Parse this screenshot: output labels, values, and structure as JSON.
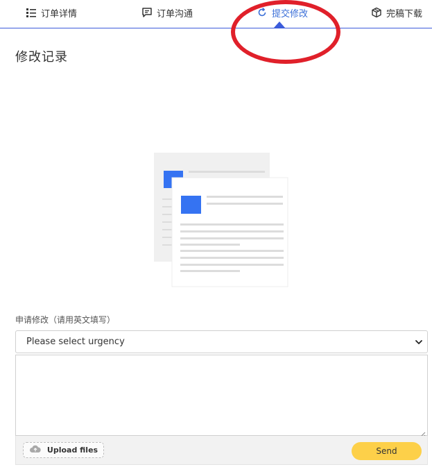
{
  "tabs": [
    {
      "label": "订单详情",
      "icon": "list-icon"
    },
    {
      "label": "订单沟通",
      "icon": "chat-icon"
    },
    {
      "label": "提交修改",
      "icon": "refresh-icon"
    },
    {
      "label": "完稿下载",
      "icon": "package-icon"
    }
  ],
  "active_tab": "提交修改",
  "section": {
    "title": "修改记录"
  },
  "form": {
    "label": "申请修改（请用英文填写）",
    "urgency_select_value": "Please select urgency",
    "upload_label": "Upload files",
    "send_label": "Send"
  },
  "colors": {
    "accent": "#3b6fd8",
    "annotation": "#e0202a",
    "send_button": "#fdd049",
    "doc_square": "#3573f2"
  }
}
